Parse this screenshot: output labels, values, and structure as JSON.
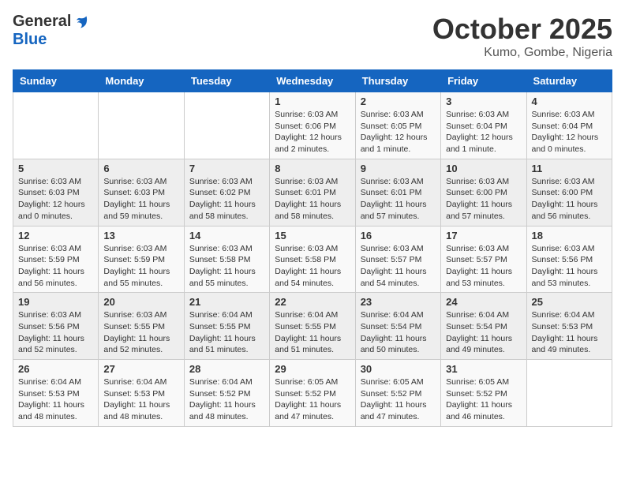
{
  "header": {
    "logo_general": "General",
    "logo_blue": "Blue",
    "month": "October 2025",
    "location": "Kumo, Gombe, Nigeria"
  },
  "days_of_week": [
    "Sunday",
    "Monday",
    "Tuesday",
    "Wednesday",
    "Thursday",
    "Friday",
    "Saturday"
  ],
  "weeks": [
    [
      {
        "day": "",
        "info": ""
      },
      {
        "day": "",
        "info": ""
      },
      {
        "day": "",
        "info": ""
      },
      {
        "day": "1",
        "info": "Sunrise: 6:03 AM\nSunset: 6:06 PM\nDaylight: 12 hours\nand 2 minutes."
      },
      {
        "day": "2",
        "info": "Sunrise: 6:03 AM\nSunset: 6:05 PM\nDaylight: 12 hours\nand 1 minute."
      },
      {
        "day": "3",
        "info": "Sunrise: 6:03 AM\nSunset: 6:04 PM\nDaylight: 12 hours\nand 1 minute."
      },
      {
        "day": "4",
        "info": "Sunrise: 6:03 AM\nSunset: 6:04 PM\nDaylight: 12 hours\nand 0 minutes."
      }
    ],
    [
      {
        "day": "5",
        "info": "Sunrise: 6:03 AM\nSunset: 6:03 PM\nDaylight: 12 hours\nand 0 minutes."
      },
      {
        "day": "6",
        "info": "Sunrise: 6:03 AM\nSunset: 6:03 PM\nDaylight: 11 hours\nand 59 minutes."
      },
      {
        "day": "7",
        "info": "Sunrise: 6:03 AM\nSunset: 6:02 PM\nDaylight: 11 hours\nand 58 minutes."
      },
      {
        "day": "8",
        "info": "Sunrise: 6:03 AM\nSunset: 6:01 PM\nDaylight: 11 hours\nand 58 minutes."
      },
      {
        "day": "9",
        "info": "Sunrise: 6:03 AM\nSunset: 6:01 PM\nDaylight: 11 hours\nand 57 minutes."
      },
      {
        "day": "10",
        "info": "Sunrise: 6:03 AM\nSunset: 6:00 PM\nDaylight: 11 hours\nand 57 minutes."
      },
      {
        "day": "11",
        "info": "Sunrise: 6:03 AM\nSunset: 6:00 PM\nDaylight: 11 hours\nand 56 minutes."
      }
    ],
    [
      {
        "day": "12",
        "info": "Sunrise: 6:03 AM\nSunset: 5:59 PM\nDaylight: 11 hours\nand 56 minutes."
      },
      {
        "day": "13",
        "info": "Sunrise: 6:03 AM\nSunset: 5:59 PM\nDaylight: 11 hours\nand 55 minutes."
      },
      {
        "day": "14",
        "info": "Sunrise: 6:03 AM\nSunset: 5:58 PM\nDaylight: 11 hours\nand 55 minutes."
      },
      {
        "day": "15",
        "info": "Sunrise: 6:03 AM\nSunset: 5:58 PM\nDaylight: 11 hours\nand 54 minutes."
      },
      {
        "day": "16",
        "info": "Sunrise: 6:03 AM\nSunset: 5:57 PM\nDaylight: 11 hours\nand 54 minutes."
      },
      {
        "day": "17",
        "info": "Sunrise: 6:03 AM\nSunset: 5:57 PM\nDaylight: 11 hours\nand 53 minutes."
      },
      {
        "day": "18",
        "info": "Sunrise: 6:03 AM\nSunset: 5:56 PM\nDaylight: 11 hours\nand 53 minutes."
      }
    ],
    [
      {
        "day": "19",
        "info": "Sunrise: 6:03 AM\nSunset: 5:56 PM\nDaylight: 11 hours\nand 52 minutes."
      },
      {
        "day": "20",
        "info": "Sunrise: 6:03 AM\nSunset: 5:55 PM\nDaylight: 11 hours\nand 52 minutes."
      },
      {
        "day": "21",
        "info": "Sunrise: 6:04 AM\nSunset: 5:55 PM\nDaylight: 11 hours\nand 51 minutes."
      },
      {
        "day": "22",
        "info": "Sunrise: 6:04 AM\nSunset: 5:55 PM\nDaylight: 11 hours\nand 51 minutes."
      },
      {
        "day": "23",
        "info": "Sunrise: 6:04 AM\nSunset: 5:54 PM\nDaylight: 11 hours\nand 50 minutes."
      },
      {
        "day": "24",
        "info": "Sunrise: 6:04 AM\nSunset: 5:54 PM\nDaylight: 11 hours\nand 49 minutes."
      },
      {
        "day": "25",
        "info": "Sunrise: 6:04 AM\nSunset: 5:53 PM\nDaylight: 11 hours\nand 49 minutes."
      }
    ],
    [
      {
        "day": "26",
        "info": "Sunrise: 6:04 AM\nSunset: 5:53 PM\nDaylight: 11 hours\nand 48 minutes."
      },
      {
        "day": "27",
        "info": "Sunrise: 6:04 AM\nSunset: 5:53 PM\nDaylight: 11 hours\nand 48 minutes."
      },
      {
        "day": "28",
        "info": "Sunrise: 6:04 AM\nSunset: 5:52 PM\nDaylight: 11 hours\nand 48 minutes."
      },
      {
        "day": "29",
        "info": "Sunrise: 6:05 AM\nSunset: 5:52 PM\nDaylight: 11 hours\nand 47 minutes."
      },
      {
        "day": "30",
        "info": "Sunrise: 6:05 AM\nSunset: 5:52 PM\nDaylight: 11 hours\nand 47 minutes."
      },
      {
        "day": "31",
        "info": "Sunrise: 6:05 AM\nSunset: 5:52 PM\nDaylight: 11 hours\nand 46 minutes."
      },
      {
        "day": "",
        "info": ""
      }
    ]
  ]
}
